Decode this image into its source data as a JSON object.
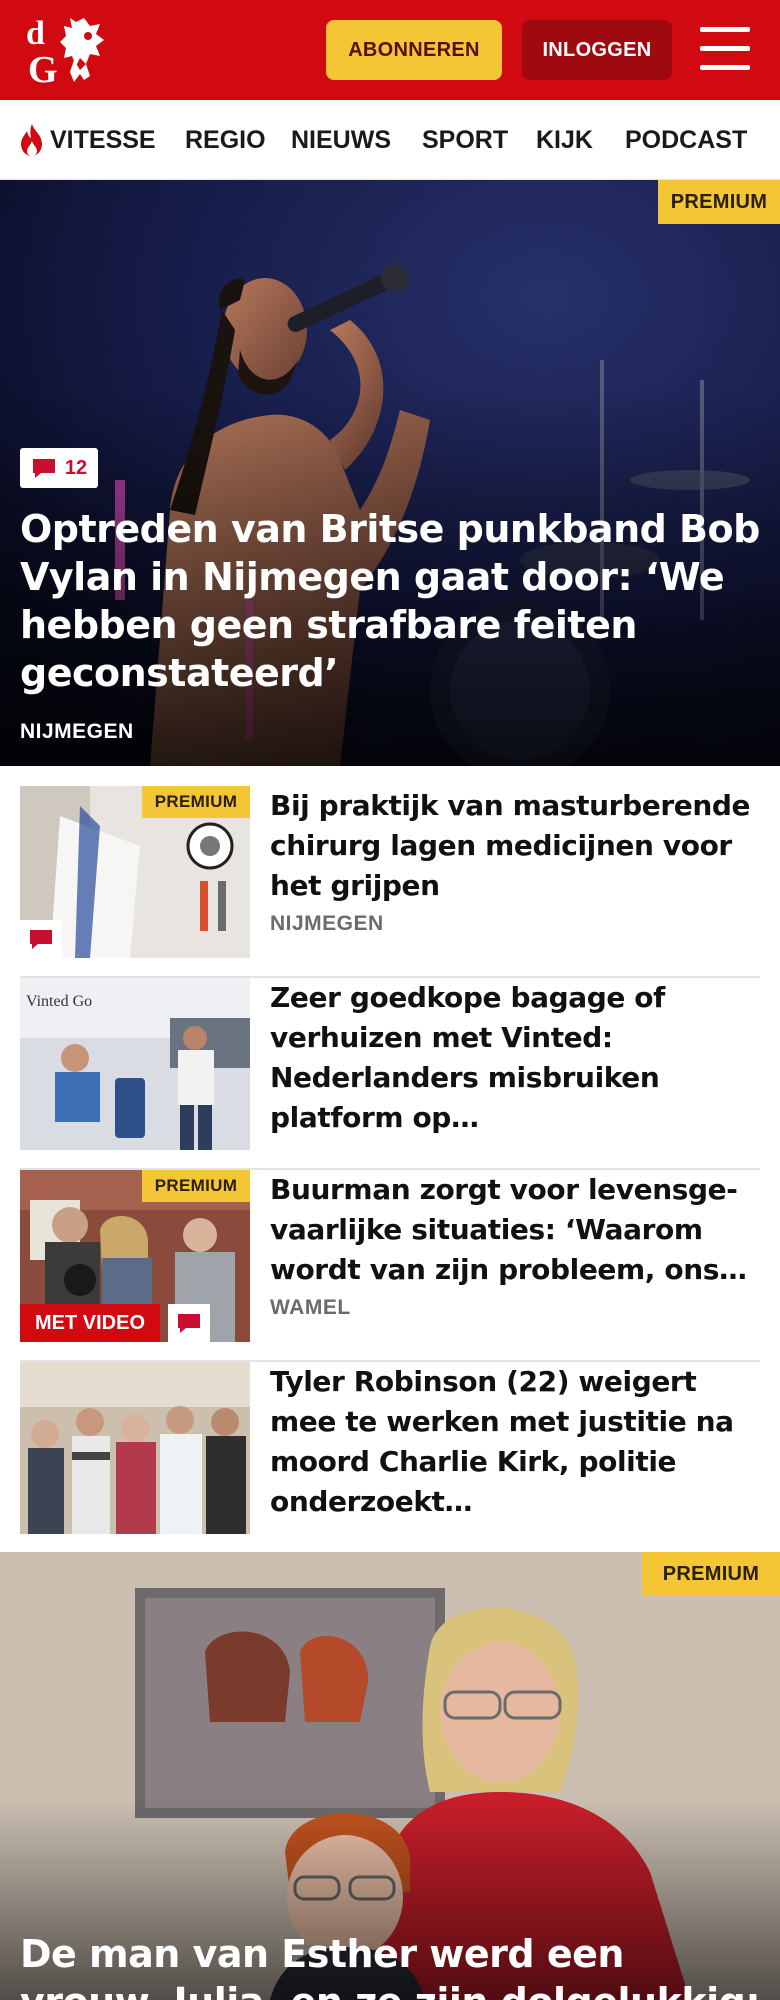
{
  "header": {
    "subscribe_label": "ABONNEREN",
    "login_label": "INLOGGEN",
    "brand_color": "#d10a11"
  },
  "nav": {
    "items": [
      {
        "label": "VITESSE",
        "icon": "flame-icon"
      },
      {
        "label": "REGIO"
      },
      {
        "label": "NIEUWS"
      },
      {
        "label": "SPORT"
      },
      {
        "label": "KIJK"
      },
      {
        "label": "PODCAST"
      }
    ]
  },
  "hero": {
    "premium_label": "PREMIUM",
    "comment_count": "12",
    "title": "Optreden van Britse punkband Bob Vylan in Nijmegen gaat door: ‘We hebben geen strafbare feiten geconstateerd’",
    "location": "NIJMEGEN"
  },
  "articles": [
    {
      "premium_label": "PREMIUM",
      "title": "Bij praktijk van masturberende chirurg lagen medicijnen voor het grijpen",
      "location": "NIJMEGEN"
    },
    {
      "title": "Zeer goedkope bagage of verhuizen met Vinted: Nederlan­ders misbruiken platform op…"
    },
    {
      "premium_label": "PREMIUM",
      "video_label": "MET VIDEO",
      "title": "Buurman zorgt voor levensge­vaarlijke situaties: ‘Waarom wordt van zijn probleem, ons…",
      "location": "WAMEL"
    },
    {
      "title": "Tyler Robinson (22) weigert mee te werken met justitie na moord Charlie Kirk, politie onderzoekt…"
    }
  ],
  "hero2": {
    "premium_label": "PREMIUM",
    "title": "De man van Esther werd een vrouw, Julia, en ze zijn dolgelukkig: ‘We"
  },
  "colors": {
    "premium": "#f4c534",
    "accent_red": "#d10a11"
  }
}
